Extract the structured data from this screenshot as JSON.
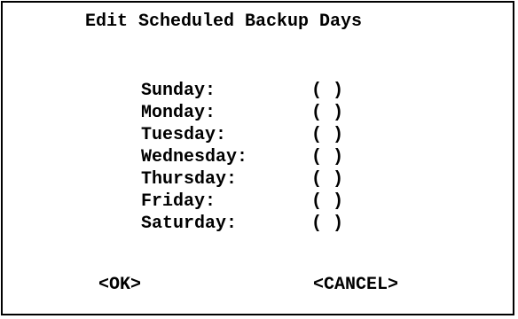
{
  "dialog": {
    "title": "Edit Scheduled Backup Days",
    "days": [
      {
        "label": "Sunday:",
        "checkbox": "( )"
      },
      {
        "label": "Monday:",
        "checkbox": "( )"
      },
      {
        "label": "Tuesday:",
        "checkbox": "( )"
      },
      {
        "label": "Wednesday:",
        "checkbox": "( )"
      },
      {
        "label": "Thursday:",
        "checkbox": "( )"
      },
      {
        "label": "Friday:",
        "checkbox": "( )"
      },
      {
        "label": "Saturday:",
        "checkbox": "( )"
      }
    ],
    "ok_label": "<OK>",
    "cancel_label": "<CANCEL>"
  }
}
